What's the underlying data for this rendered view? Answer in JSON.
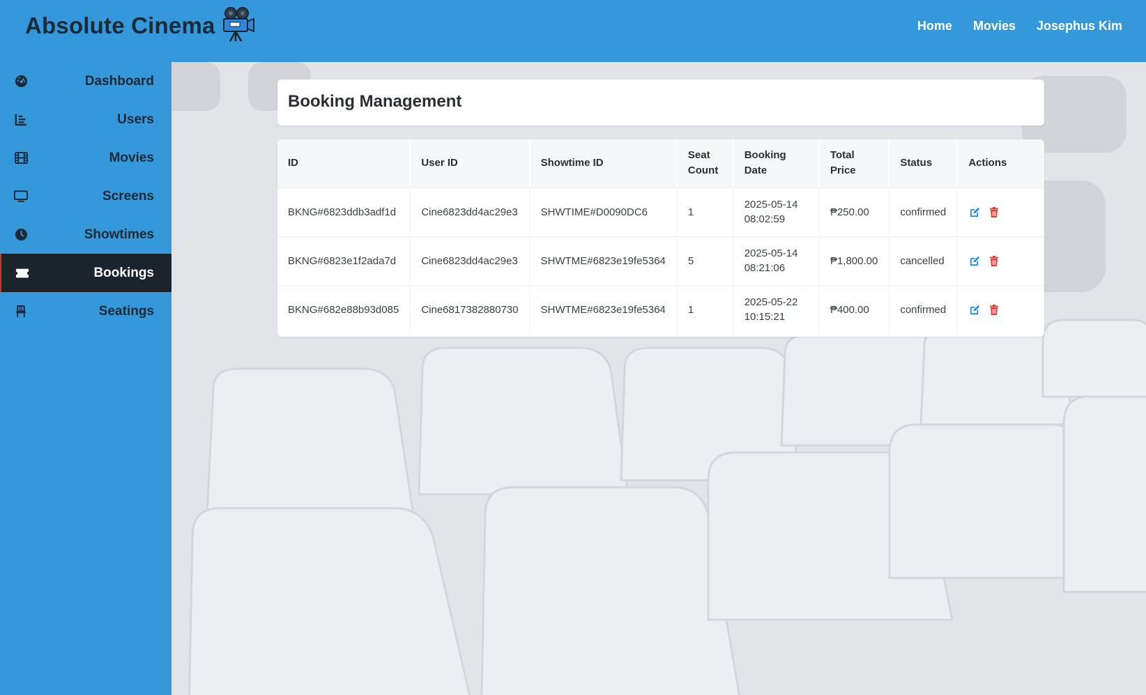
{
  "header": {
    "brand": "Absolute Cinema",
    "logo_icon": "movie-camera-icon",
    "nav": [
      {
        "label": "Home"
      },
      {
        "label": "Movies"
      },
      {
        "label": "Josephus Kim"
      }
    ]
  },
  "sidebar": {
    "items": [
      {
        "label": "Dashboard",
        "icon": "gauge-icon"
      },
      {
        "label": "Users",
        "icon": "chart-icon"
      },
      {
        "label": "Movies",
        "icon": "film-icon"
      },
      {
        "label": "Screens",
        "icon": "monitor-icon"
      },
      {
        "label": "Showtimes",
        "icon": "clock-icon"
      },
      {
        "label": "Bookings",
        "icon": "ticket-icon",
        "active": true
      },
      {
        "label": "Seatings",
        "icon": "chair-icon"
      }
    ]
  },
  "page": {
    "title": "Booking Management"
  },
  "table": {
    "columns": [
      "ID",
      "User ID",
      "Showtime ID",
      "Seat Count",
      "Booking Date",
      "Total Price",
      "Status",
      "Actions"
    ],
    "rows": [
      {
        "id": "BKNG#6823ddb3adf1d",
        "user_id": "Cine6823dd4ac29e3",
        "showtime_id": "SHWTIME#D0090DC6",
        "seat_count": "1",
        "booking_date": "2025-05-14 08:02:59",
        "total_price": "₱250.00",
        "status": "confirmed"
      },
      {
        "id": "BKNG#6823e1f2ada7d",
        "user_id": "Cine6823dd4ac29e3",
        "showtime_id": "SHWTME#6823e19fe5364",
        "seat_count": "5",
        "booking_date": "2025-05-14 08:21:06",
        "total_price": "₱1,800.00",
        "status": "cancelled"
      },
      {
        "id": "BKNG#682e88b93d085",
        "user_id": "Cine6817382880730",
        "showtime_id": "SHWTME#6823e19fe5364",
        "seat_count": "1",
        "booking_date": "2025-05-22 10:15:21",
        "total_price": "₱400.00",
        "status": "confirmed"
      }
    ],
    "action_icons": [
      "edit-icon",
      "trash-icon"
    ]
  },
  "colors": {
    "header_bg": "#3498db",
    "sidebar_active_bg": "#1b242c",
    "edit_icon": "#1e88e5",
    "delete_icon": "#e53935"
  }
}
